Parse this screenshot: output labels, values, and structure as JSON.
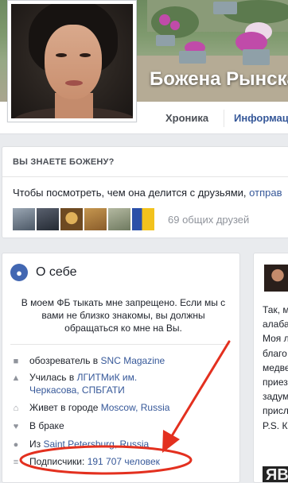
{
  "colors": {
    "accent": "#365899",
    "annotation": "#e3301f"
  },
  "profile": {
    "name": "Божена Рынска",
    "tabs": [
      {
        "label": "Хроника"
      },
      {
        "label": "Информац"
      }
    ]
  },
  "know": {
    "title": "ВЫ ЗНАЕТЕ БОЖЕНУ?",
    "text": "Чтобы посмотреть, чем она делится с друзьями, ",
    "link": "отправ",
    "mutual": "69 общих друзей",
    "friend_count_shown": 6
  },
  "about": {
    "title": "О себе",
    "bio": "В моем ФБ тыкать мне запрещено. Если мы с вами не близко знакомы, вы должны обращаться ко мне на Вы.",
    "rows": [
      {
        "icon": "briefcase-icon",
        "prefix": "обозреватель в ",
        "link": "SNC Magazine",
        "suffix": ""
      },
      {
        "icon": "graduation-cap-icon",
        "prefix": "Училась в ",
        "link": "ЛГИТМиК им. Черкасова, СПБГАТИ",
        "suffix": ""
      },
      {
        "icon": "home-icon",
        "prefix": "Живет в городе ",
        "link": "Moscow, Russia",
        "suffix": ""
      },
      {
        "icon": "heart-icon",
        "prefix": "В браке",
        "link": "",
        "suffix": ""
      },
      {
        "icon": "location-pin-icon",
        "prefix": "Из ",
        "link": "Saint Petersburg, Russia",
        "suffix": ""
      },
      {
        "icon": "rss-icon",
        "prefix": "Подписчики: ",
        "link": "191 707 человек",
        "suffix": ""
      }
    ]
  },
  "feed": {
    "lines": [
      "Так, м",
      "алаба",
      "Моя л",
      "благо",
      "медве",
      "приез",
      "задум",
      "присл",
      "P.S. К"
    ],
    "photo_text": "ЯВ"
  }
}
